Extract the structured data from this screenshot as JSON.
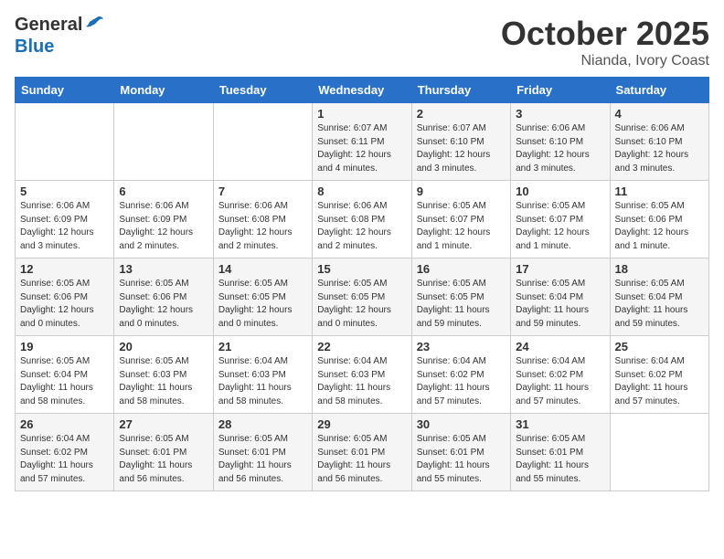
{
  "header": {
    "logo_general": "General",
    "logo_blue": "Blue",
    "month": "October 2025",
    "location": "Nianda, Ivory Coast"
  },
  "weekdays": [
    "Sunday",
    "Monday",
    "Tuesday",
    "Wednesday",
    "Thursday",
    "Friday",
    "Saturday"
  ],
  "weeks": [
    [
      {
        "day": "",
        "info": ""
      },
      {
        "day": "",
        "info": ""
      },
      {
        "day": "",
        "info": ""
      },
      {
        "day": "1",
        "info": "Sunrise: 6:07 AM\nSunset: 6:11 PM\nDaylight: 12 hours\nand 4 minutes."
      },
      {
        "day": "2",
        "info": "Sunrise: 6:07 AM\nSunset: 6:10 PM\nDaylight: 12 hours\nand 3 minutes."
      },
      {
        "day": "3",
        "info": "Sunrise: 6:06 AM\nSunset: 6:10 PM\nDaylight: 12 hours\nand 3 minutes."
      },
      {
        "day": "4",
        "info": "Sunrise: 6:06 AM\nSunset: 6:10 PM\nDaylight: 12 hours\nand 3 minutes."
      }
    ],
    [
      {
        "day": "5",
        "info": "Sunrise: 6:06 AM\nSunset: 6:09 PM\nDaylight: 12 hours\nand 3 minutes."
      },
      {
        "day": "6",
        "info": "Sunrise: 6:06 AM\nSunset: 6:09 PM\nDaylight: 12 hours\nand 2 minutes."
      },
      {
        "day": "7",
        "info": "Sunrise: 6:06 AM\nSunset: 6:08 PM\nDaylight: 12 hours\nand 2 minutes."
      },
      {
        "day": "8",
        "info": "Sunrise: 6:06 AM\nSunset: 6:08 PM\nDaylight: 12 hours\nand 2 minutes."
      },
      {
        "day": "9",
        "info": "Sunrise: 6:05 AM\nSunset: 6:07 PM\nDaylight: 12 hours\nand 1 minute."
      },
      {
        "day": "10",
        "info": "Sunrise: 6:05 AM\nSunset: 6:07 PM\nDaylight: 12 hours\nand 1 minute."
      },
      {
        "day": "11",
        "info": "Sunrise: 6:05 AM\nSunset: 6:06 PM\nDaylight: 12 hours\nand 1 minute."
      }
    ],
    [
      {
        "day": "12",
        "info": "Sunrise: 6:05 AM\nSunset: 6:06 PM\nDaylight: 12 hours\nand 0 minutes."
      },
      {
        "day": "13",
        "info": "Sunrise: 6:05 AM\nSunset: 6:06 PM\nDaylight: 12 hours\nand 0 minutes."
      },
      {
        "day": "14",
        "info": "Sunrise: 6:05 AM\nSunset: 6:05 PM\nDaylight: 12 hours\nand 0 minutes."
      },
      {
        "day": "15",
        "info": "Sunrise: 6:05 AM\nSunset: 6:05 PM\nDaylight: 12 hours\nand 0 minutes."
      },
      {
        "day": "16",
        "info": "Sunrise: 6:05 AM\nSunset: 6:05 PM\nDaylight: 11 hours\nand 59 minutes."
      },
      {
        "day": "17",
        "info": "Sunrise: 6:05 AM\nSunset: 6:04 PM\nDaylight: 11 hours\nand 59 minutes."
      },
      {
        "day": "18",
        "info": "Sunrise: 6:05 AM\nSunset: 6:04 PM\nDaylight: 11 hours\nand 59 minutes."
      }
    ],
    [
      {
        "day": "19",
        "info": "Sunrise: 6:05 AM\nSunset: 6:04 PM\nDaylight: 11 hours\nand 58 minutes."
      },
      {
        "day": "20",
        "info": "Sunrise: 6:05 AM\nSunset: 6:03 PM\nDaylight: 11 hours\nand 58 minutes."
      },
      {
        "day": "21",
        "info": "Sunrise: 6:04 AM\nSunset: 6:03 PM\nDaylight: 11 hours\nand 58 minutes."
      },
      {
        "day": "22",
        "info": "Sunrise: 6:04 AM\nSunset: 6:03 PM\nDaylight: 11 hours\nand 58 minutes."
      },
      {
        "day": "23",
        "info": "Sunrise: 6:04 AM\nSunset: 6:02 PM\nDaylight: 11 hours\nand 57 minutes."
      },
      {
        "day": "24",
        "info": "Sunrise: 6:04 AM\nSunset: 6:02 PM\nDaylight: 11 hours\nand 57 minutes."
      },
      {
        "day": "25",
        "info": "Sunrise: 6:04 AM\nSunset: 6:02 PM\nDaylight: 11 hours\nand 57 minutes."
      }
    ],
    [
      {
        "day": "26",
        "info": "Sunrise: 6:04 AM\nSunset: 6:02 PM\nDaylight: 11 hours\nand 57 minutes."
      },
      {
        "day": "27",
        "info": "Sunrise: 6:05 AM\nSunset: 6:01 PM\nDaylight: 11 hours\nand 56 minutes."
      },
      {
        "day": "28",
        "info": "Sunrise: 6:05 AM\nSunset: 6:01 PM\nDaylight: 11 hours\nand 56 minutes."
      },
      {
        "day": "29",
        "info": "Sunrise: 6:05 AM\nSunset: 6:01 PM\nDaylight: 11 hours\nand 56 minutes."
      },
      {
        "day": "30",
        "info": "Sunrise: 6:05 AM\nSunset: 6:01 PM\nDaylight: 11 hours\nand 55 minutes."
      },
      {
        "day": "31",
        "info": "Sunrise: 6:05 AM\nSunset: 6:01 PM\nDaylight: 11 hours\nand 55 minutes."
      },
      {
        "day": "",
        "info": ""
      }
    ]
  ]
}
